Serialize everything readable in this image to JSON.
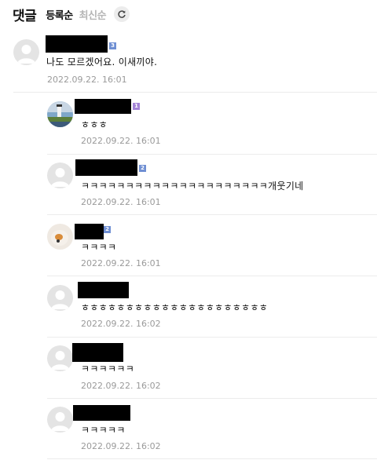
{
  "header": {
    "title": "댓글",
    "sort_registered": "등록순",
    "sort_latest": "최신순",
    "refresh_icon": "refresh-icon"
  },
  "colors": {
    "badge_blue": "#6f8fd3",
    "badge_purple": "#a383d6",
    "date_gray": "#9a9a9a",
    "inactive_sort": "#b5b5b5"
  },
  "comments": [
    {
      "avatar": "default",
      "badge": "3",
      "text": "나도 모르겠어요. 이새끼야.",
      "date": "2022.09.22. 16:01"
    },
    {
      "avatar": "photo-lighthouse",
      "badge": "1",
      "text": "ㅎㅎㅎ",
      "date": "2022.09.22. 16:01"
    },
    {
      "avatar": "default",
      "badge": "2",
      "text": "ㅋㅋㅋㅋㅋㅋㅋㅋㅋㅋㅋㅋㅋㅋㅋㅋㅋㅋㅋㅋㅋ개웃기네",
      "date": "2022.09.22. 16:01"
    },
    {
      "avatar": "photo-cat",
      "badge": "2",
      "text": "ㅋㅋㅋㅋ",
      "date": "2022.09.22. 16:01"
    },
    {
      "avatar": "default",
      "badge": "",
      "text": "ㅎㅎㅎㅎㅎㅎㅎㅎㅎㅎㅎㅎㅎㅎㅎㅎㅎㅎㅎㅎㅎ",
      "date": "2022.09.22. 16:02"
    },
    {
      "avatar": "default",
      "badge": "",
      "text": "ㅋㅋㅋㅋㅋㅋ",
      "date": "2022.09.22. 16:02"
    },
    {
      "avatar": "default",
      "badge": "",
      "text": "ㅋㅋㅋㅋㅋ",
      "date": "2022.09.22. 16:02"
    }
  ]
}
